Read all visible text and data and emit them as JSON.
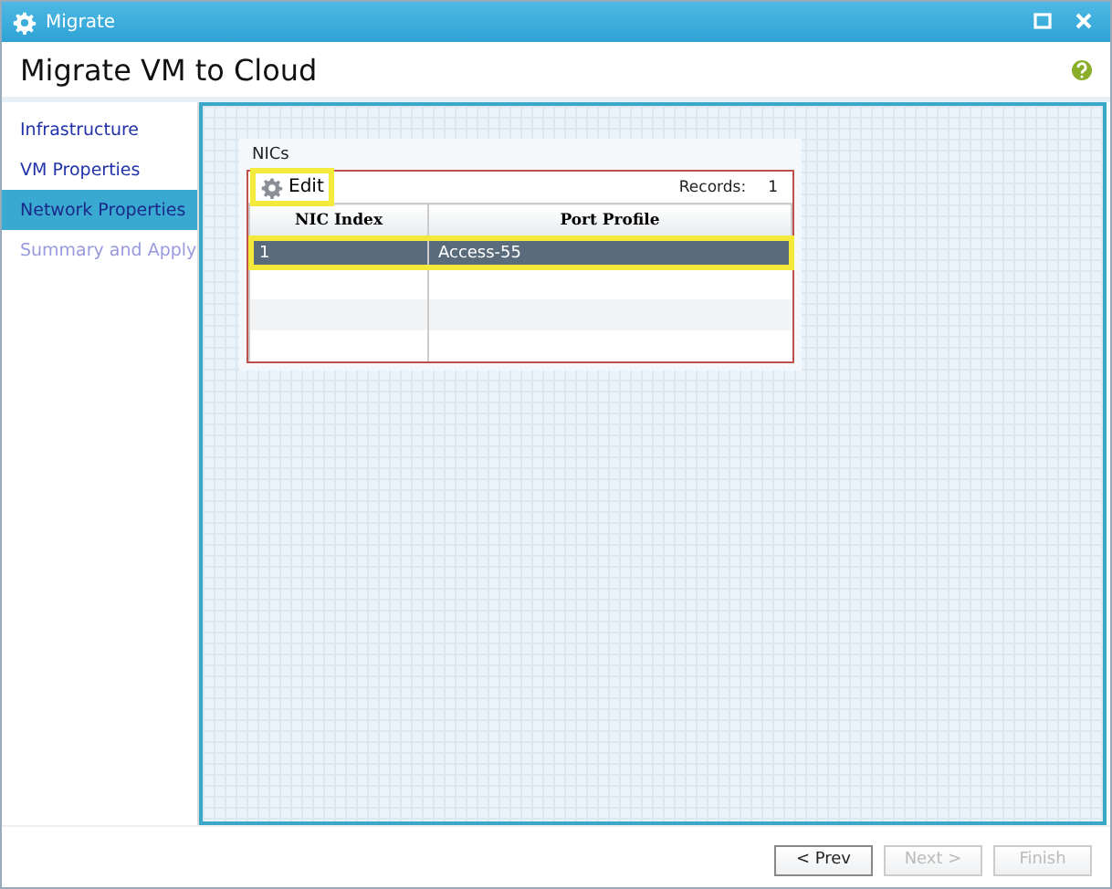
{
  "window": {
    "title": "Migrate"
  },
  "header": {
    "title": "Migrate VM to Cloud"
  },
  "sidebar": {
    "items": [
      {
        "label": "Infrastructure",
        "selected": false,
        "disabled": false
      },
      {
        "label": "VM Properties",
        "selected": false,
        "disabled": false
      },
      {
        "label": "Network Properties",
        "selected": true,
        "disabled": false
      },
      {
        "label": "Summary and Apply",
        "selected": false,
        "disabled": true
      }
    ]
  },
  "nics": {
    "title": "NICs",
    "edit": {
      "label": "Edit",
      "highlighted": true
    },
    "records_label": "Records:",
    "records_count": "1",
    "columns": [
      "NIC Index",
      "Port Profile"
    ],
    "rows": [
      {
        "cells": [
          "1",
          "Access-55"
        ],
        "selected": true,
        "highlighted": true
      }
    ]
  },
  "buttons": [
    {
      "label": "< Prev",
      "disabled": false
    },
    {
      "label": "Next >",
      "disabled": true
    },
    {
      "label": "Finish",
      "disabled": true
    }
  ]
}
